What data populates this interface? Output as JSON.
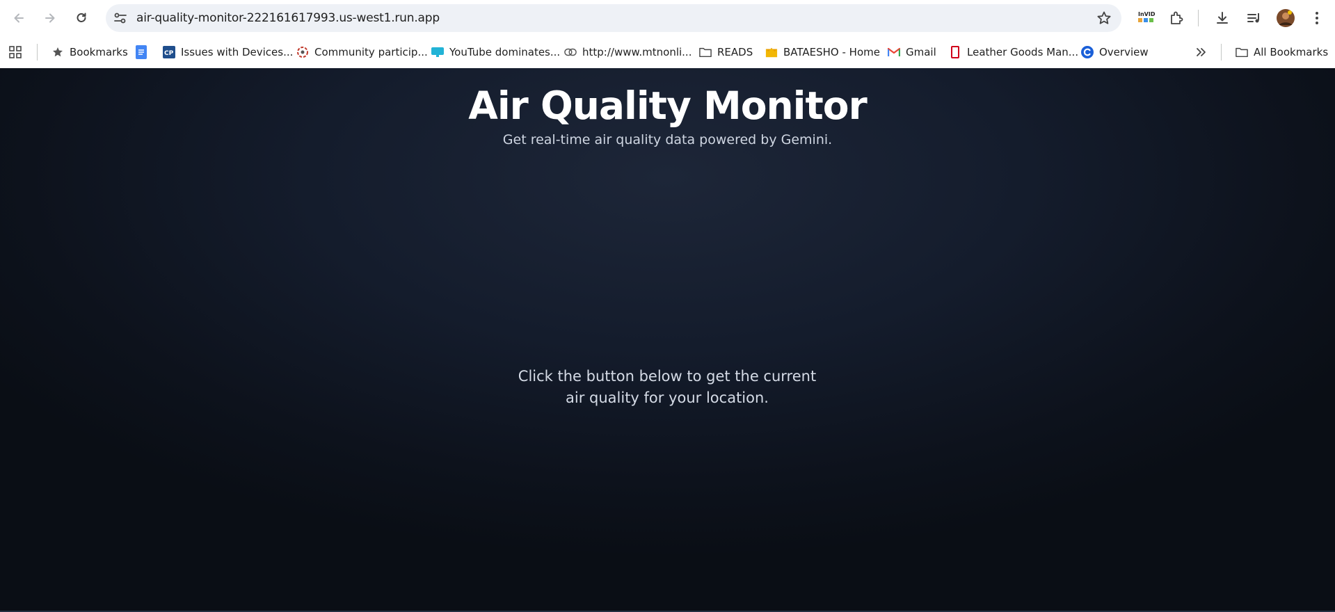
{
  "browser": {
    "url": "air-quality-monitor-222161617993.us-west1.run.app",
    "bookmarks": [
      {
        "label": "Bookmarks",
        "icon": "star-icon"
      },
      {
        "label": "",
        "icon": "google-docs-icon"
      },
      {
        "label": "Issues with Devices...",
        "icon": "cp-icon"
      },
      {
        "label": "Community particip...",
        "icon": "community-icon"
      },
      {
        "label": "YouTube dominates...",
        "icon": "youtube-site-icon"
      },
      {
        "label": "http://www.mtnonli...",
        "icon": "link-icon"
      },
      {
        "label": "READS",
        "icon": "folder-icon"
      },
      {
        "label": "BATAESHO - Home",
        "icon": "crown-icon"
      },
      {
        "label": "Gmail",
        "icon": "gmail-icon"
      },
      {
        "label": "Leather Goods Man...",
        "icon": "red-bookmark-icon"
      },
      {
        "label": "Overview",
        "icon": "c-logo-icon"
      }
    ],
    "all_bookmarks_label": "All Bookmarks"
  },
  "app": {
    "title": "Air Quality Monitor",
    "subtitle": "Get real-time air quality data powered by Gemini.",
    "prompt": "Click the button below to get the current air quality for your location."
  },
  "colors": {
    "background": "#141c2c",
    "title": "#ffffff",
    "text": "#d5dbe6"
  }
}
